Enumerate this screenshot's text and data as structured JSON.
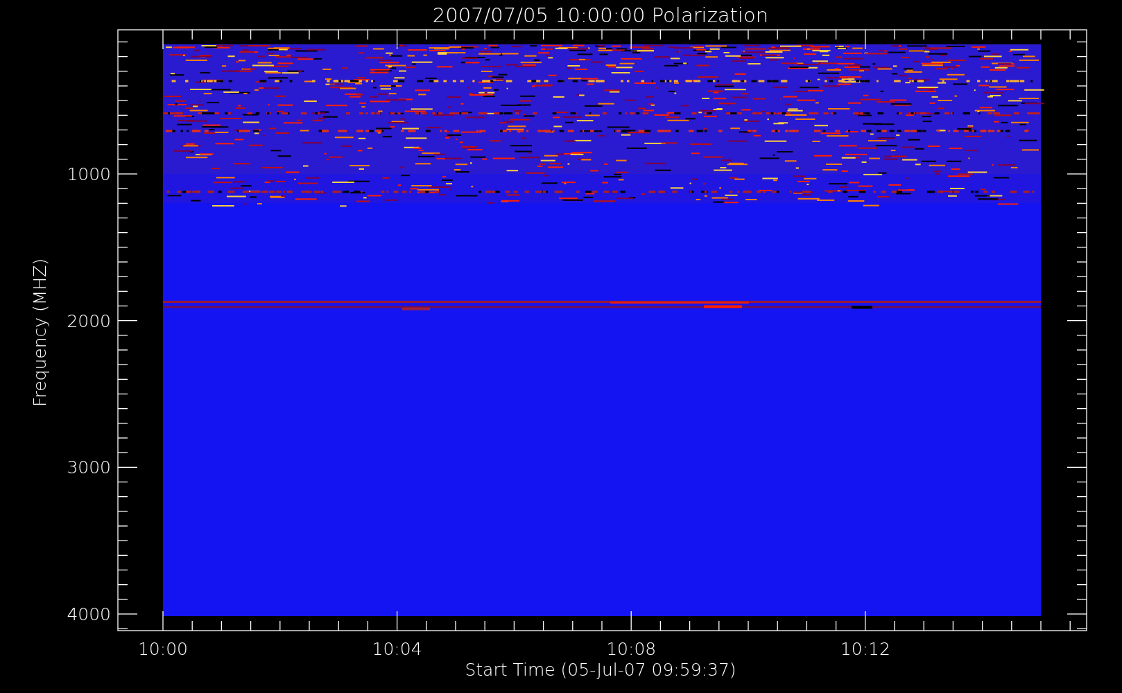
{
  "plot": {
    "title": "2007/07/05 10:00:00 Polarization",
    "y_axis": {
      "label": "Frequency (MHZ)",
      "ticks": [
        "1000",
        "2000",
        "3000",
        "4000"
      ]
    },
    "x_axis": {
      "label": "Start Time (05-Jul-07 09:59:37)",
      "ticks": [
        "10:00",
        "10:04",
        "10:08",
        "10:12"
      ]
    }
  }
}
